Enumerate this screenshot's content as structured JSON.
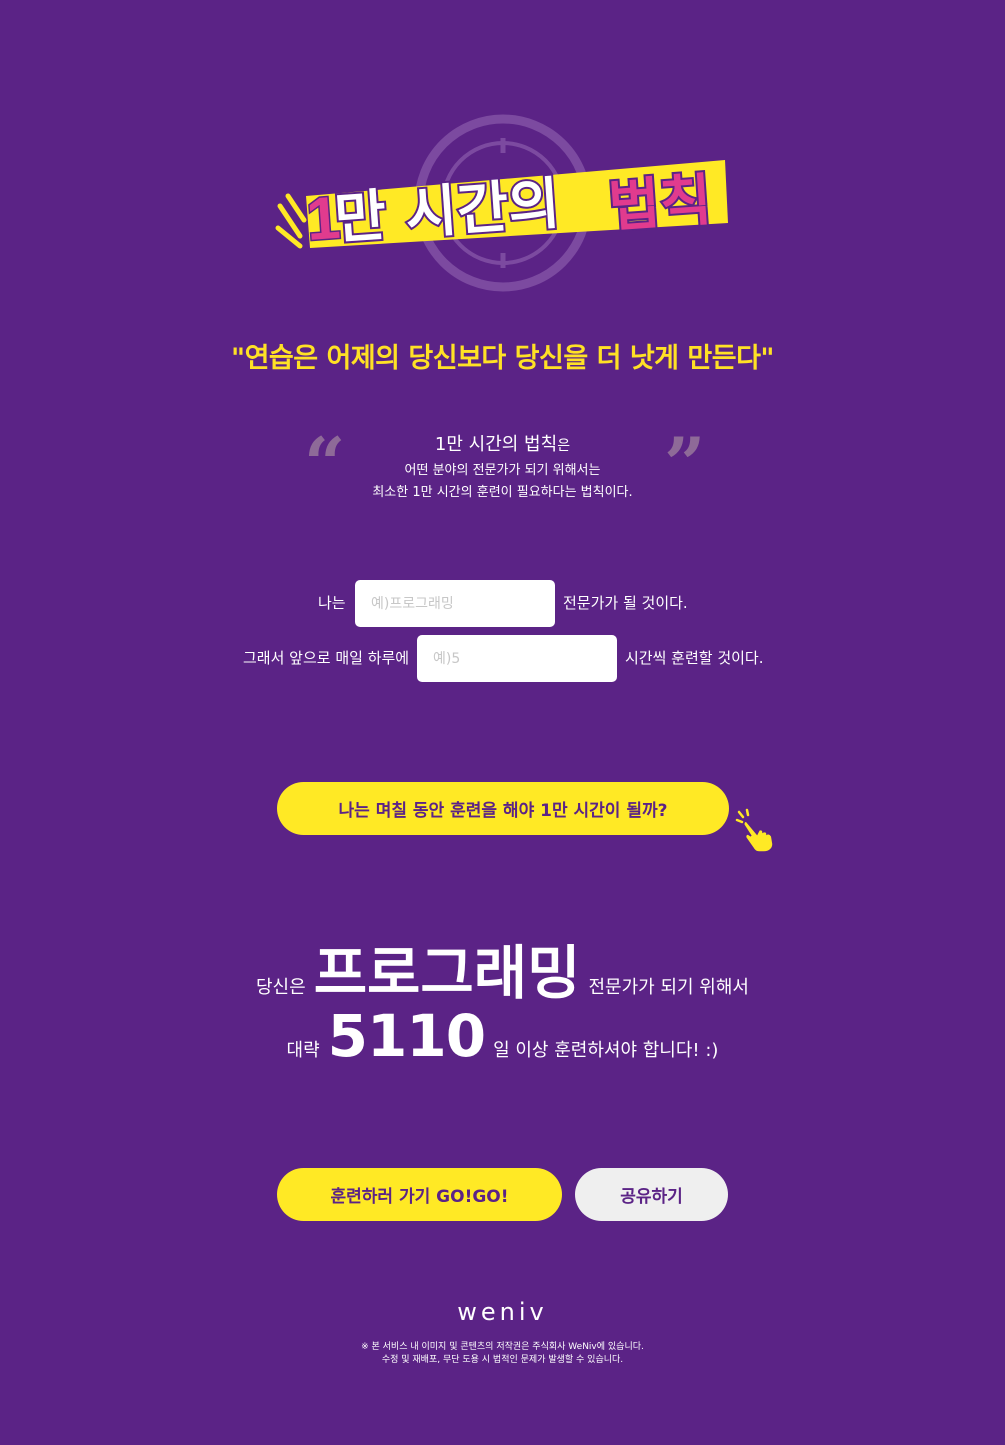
{
  "hero": {
    "title_number": "1",
    "title_part1": "만 시간의 ",
    "title_part2": "법칙"
  },
  "motto": "\"연습은 어제의 당신보다 당신을 더 낫게 만든다\"",
  "quote": {
    "open_mark": "“",
    "close_mark": "”",
    "title": "1만 시간의 법칙",
    "title_suffix": "은",
    "line1": "어떤 분야의 전문가가 되기 위해서는",
    "line2": "최소한 1만 시간의 훈련이 필요하다는 법칙이다."
  },
  "form": {
    "field_prefix": "나는",
    "field_placeholder": "예)프로그래밍",
    "field_suffix": "전문가가 될 것이다.",
    "hours_prefix": "그래서 앞으로 매일 하루에",
    "hours_placeholder": "예)5",
    "hours_suffix": "시간씩 훈련할 것이다."
  },
  "calc_button": "나는 며칠 동안 훈련을 해야 1만 시간이 될까?",
  "result": {
    "prefix": "당신은",
    "field": "프로그래밍",
    "field_suffix": "전문가가 되기 위해서",
    "days_prefix": "대략",
    "days": "5110",
    "days_suffix": "일 이상 훈련하셔야 합니다! :)"
  },
  "actions": {
    "go": "훈련하러 가기 GO!GO!",
    "share": "공유하기"
  },
  "footer": {
    "logo": "weniv",
    "note1": "※ 본 서비스 내 이미지 및 콘텐츠의 저작권은 주식회사 WeNiv에 있습니다.",
    "note2": "수정 및 재배포, 무단 도용 시 법적인 문제가 발생할 수 있습니다."
  },
  "colors": {
    "background": "#5b2386",
    "accent_yellow": "#ffe925",
    "accent_pink": "#e13b8e",
    "button_gray": "#efefef"
  },
  "icons": {
    "hero_clock": "clock-icon",
    "pointer": "pointing-hand-icon"
  }
}
